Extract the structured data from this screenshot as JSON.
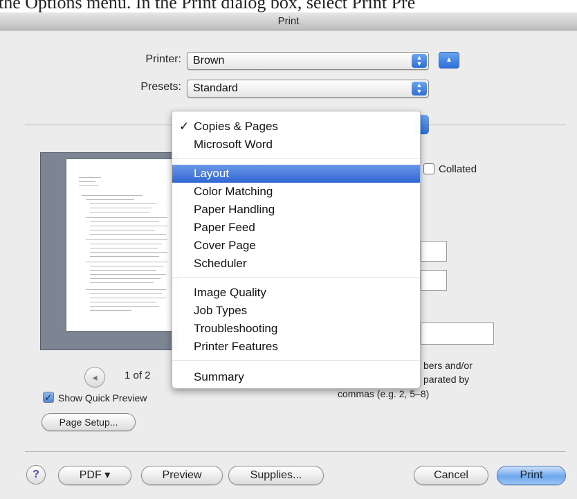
{
  "document_text": "the Options menu. In the Print dialog box, select Print Pre",
  "window": {
    "title": "Print"
  },
  "printer": {
    "label": "Printer:",
    "value": "Brown"
  },
  "presets": {
    "label": "Presets:",
    "value": "Standard"
  },
  "menu": {
    "groups": [
      [
        {
          "label": "Copies & Pages",
          "checked": true
        },
        {
          "label": "Microsoft Word"
        }
      ],
      [
        {
          "label": "Layout",
          "highlighted": true
        },
        {
          "label": "Color Matching"
        },
        {
          "label": "Paper Handling"
        },
        {
          "label": "Paper Feed"
        },
        {
          "label": "Cover Page"
        },
        {
          "label": "Scheduler"
        }
      ],
      [
        {
          "label": "Image Quality"
        },
        {
          "label": "Job Types"
        },
        {
          "label": "Troubleshooting"
        },
        {
          "label": "Printer Features"
        }
      ],
      [
        {
          "label": "Summary"
        }
      ]
    ],
    "check_mark": "✓"
  },
  "copies": {
    "collated_label": "Collated",
    "collated": false
  },
  "pages": {
    "hint_fragment_1": "bers and/or",
    "hint_fragment_2": "parated by",
    "hint_line_3": "commas (e.g. 2, 5–8)"
  },
  "preview": {
    "page_indicator": "1 of 2"
  },
  "quick_preview": {
    "label": "Show Quick Preview",
    "checked": true
  },
  "buttons": {
    "page_setup": "Page Setup...",
    "help": "?",
    "pdf": "PDF ▾",
    "preview": "Preview",
    "supplies": "Supplies...",
    "cancel": "Cancel",
    "print": "Print"
  },
  "colors": {
    "accent": "#2f66d2",
    "selection": "#3b6fd6"
  }
}
